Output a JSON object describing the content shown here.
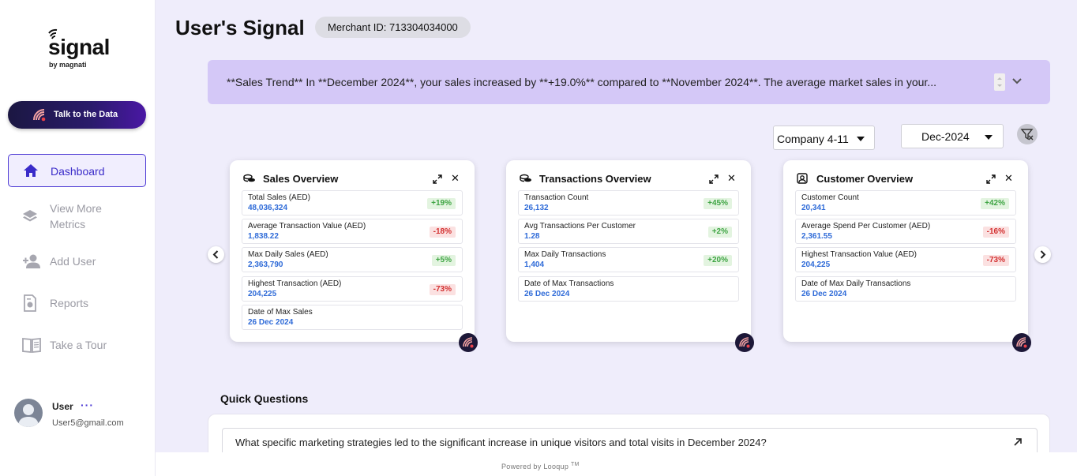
{
  "brand": {
    "name": "signal",
    "tagline": "by magnati"
  },
  "sidebar": {
    "talk_button": "Talk to the Data",
    "items": [
      {
        "label": "Dashboard",
        "icon": "home-icon",
        "active": true
      },
      {
        "label": "View More Metrics",
        "icon": "layers-icon",
        "active": false
      },
      {
        "label": "Add User",
        "icon": "add-user-icon",
        "active": false
      },
      {
        "label": "Reports",
        "icon": "report-icon",
        "active": false
      },
      {
        "label": "Take a Tour",
        "icon": "book-icon",
        "active": false
      }
    ],
    "user": {
      "name": "User",
      "more": "···",
      "email": "User5@gmail.com"
    }
  },
  "header": {
    "title": "User's Signal",
    "merchant_id": "Merchant ID: 713304034000"
  },
  "banner": {
    "text": "**Sales Trend** In **December 2024**, your sales increased by **+19.0%** compared to **November 2024**. The average market sales in your..."
  },
  "filters": {
    "company": "Company 4-11",
    "period": "Dec-2024"
  },
  "cards": [
    {
      "title": "Sales Overview",
      "icon": "coins-icon",
      "metrics": [
        {
          "label": "Total Sales (AED)",
          "value": "48,036,324",
          "change": "+19%",
          "direction": "up"
        },
        {
          "label": "Average Transaction Value (AED)",
          "value": "1,838.22",
          "change": "-18%",
          "direction": "down"
        },
        {
          "label": "Max Daily Sales (AED)",
          "value": "2,363,790",
          "change": "+5%",
          "direction": "up"
        },
        {
          "label": "Highest Transaction (AED)",
          "value": "204,225",
          "change": "-73%",
          "direction": "down"
        },
        {
          "label": "Date of Max Sales",
          "value": "26 Dec 2024",
          "change": "",
          "direction": ""
        }
      ]
    },
    {
      "title": "Transactions Overview",
      "icon": "coins-icon",
      "metrics": [
        {
          "label": "Transaction Count",
          "value": "26,132",
          "change": "+45%",
          "direction": "up"
        },
        {
          "label": "Avg Transactions Per Customer",
          "value": "1.28",
          "change": "+2%",
          "direction": "up"
        },
        {
          "label": "Max Daily Transactions",
          "value": "1,404",
          "change": "+20%",
          "direction": "up"
        },
        {
          "label": "Date of Max Transactions",
          "value": "26 Dec 2024",
          "change": "",
          "direction": ""
        }
      ]
    },
    {
      "title": "Customer Overview",
      "icon": "user-badge-icon",
      "metrics": [
        {
          "label": "Customer Count",
          "value": "20,341",
          "change": "+42%",
          "direction": "up"
        },
        {
          "label": "Average Spend Per Customer (AED)",
          "value": "2,361.55",
          "change": "-16%",
          "direction": "down"
        },
        {
          "label": "Highest Transaction Value (AED)",
          "value": "204,225",
          "change": "-73%",
          "direction": "down"
        },
        {
          "label": "Date of Max Daily Transactions",
          "value": "26 Dec 2024",
          "change": "",
          "direction": ""
        }
      ]
    }
  ],
  "quick_questions": {
    "title": "Quick Questions",
    "items": [
      "What specific marketing strategies led to the significant increase in unique visitors and total visits in December 2024?"
    ]
  },
  "footer": {
    "text": "Powered by Looqup",
    "mark": "TM"
  },
  "colors": {
    "accent": "#4c39d4",
    "up": "#3fa544",
    "down": "#d33030",
    "value": "#2f6bd8",
    "banner": "#d4c8f7"
  }
}
